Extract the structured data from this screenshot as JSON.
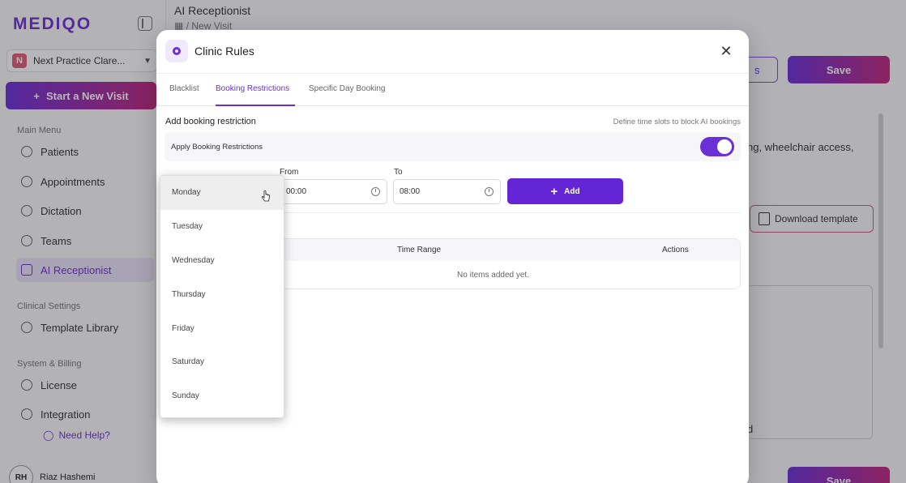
{
  "app": {
    "logo": "MEDIQO"
  },
  "sidebar": {
    "practice": {
      "initial": "N",
      "name": "Next Practice Clare..."
    },
    "start_visit": "Start a New Visit",
    "main_menu_title": "Main Menu",
    "main_menu": [
      {
        "label": "Patients",
        "icon": "users-icon"
      },
      {
        "label": "Appointments",
        "icon": "calendar-icon"
      },
      {
        "label": "Dictation",
        "icon": "mic-icon"
      },
      {
        "label": "Teams",
        "icon": "team-icon"
      },
      {
        "label": "AI Receptionist",
        "icon": "grid-icon",
        "active": true
      }
    ],
    "clinical_title": "Clinical Settings",
    "clinical": [
      {
        "label": "Template Library",
        "icon": "template-icon"
      }
    ],
    "billing_title": "System & Billing",
    "billing": [
      {
        "label": "License",
        "icon": "license-icon"
      },
      {
        "label": "Integration",
        "icon": "integration-icon"
      }
    ],
    "need_help": "Need Help?",
    "user": {
      "initials": "RH",
      "name": "Riaz Hashemi"
    }
  },
  "main": {
    "title": "AI Receptionist",
    "breadcrumb_sep": "/",
    "breadcrumb": "New Visit",
    "save_label": "Save",
    "outline_btn_label": "s",
    "body_text": "ng, wheelchair access,",
    "download_template": "Download template",
    "fragment_d": "d"
  },
  "modal": {
    "title": "Clinic Rules",
    "tabs": [
      {
        "label": "Blacklist"
      },
      {
        "label": "Booking Restrictions",
        "active": true
      },
      {
        "label": "Specific Day Booking"
      }
    ],
    "section_title": "Add booking restriction",
    "section_hint": "Define time slots to block AI bookings",
    "apply_label": "Apply Booking Restrictions",
    "apply_enabled": true,
    "from_label": "From",
    "from_value": "00:00",
    "to_label": "To",
    "to_value": "08:00",
    "add_label": "Add",
    "table": {
      "columns": [
        "Time Range",
        "Actions"
      ],
      "empty_text": "No items added yet."
    }
  },
  "day_dropdown": {
    "options": [
      "Monday",
      "Tuesday",
      "Wednesday",
      "Thursday",
      "Friday",
      "Saturday",
      "Sunday"
    ],
    "hovered": "Monday"
  },
  "colors": {
    "accent": "#6a2fd6",
    "gradient_end": "#c0257c"
  }
}
